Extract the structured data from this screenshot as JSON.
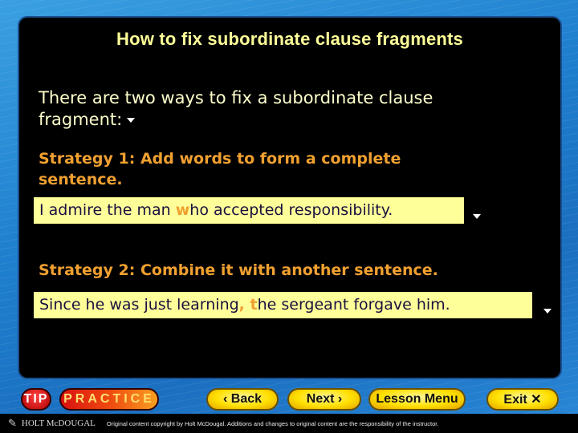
{
  "slide": {
    "title": "How to fix subordinate clause fragments",
    "intro": "There are two ways to fix a subordinate clause fragment:",
    "strategy1": {
      "heading": "Strategy 1: Add words to form a complete sentence.",
      "example_before": "I admire the man ",
      "example_highlight": "w",
      "example_after": "ho accepted responsibility."
    },
    "strategy2": {
      "heading": "Strategy 2: Combine it with another sentence.",
      "example_before": "Since he was just learning",
      "example_highlight": ", t",
      "example_after": "he sergeant forgave him."
    }
  },
  "nav": {
    "tip": "TIP",
    "practice": "PRACTICE",
    "back": "‹ Back",
    "next": "Next ›",
    "lesson_menu": "Lesson Menu",
    "exit": "Exit ✕"
  },
  "footer": {
    "logo": "HOLT McDOUGAL",
    "copyright": "Original content copyright by Holt McDougal. Additions and changes to original content are the responsibility of the instructor."
  },
  "colors": {
    "title": "#ffff99",
    "strategy": "#f0a030",
    "example_bg": "#ffff99"
  }
}
